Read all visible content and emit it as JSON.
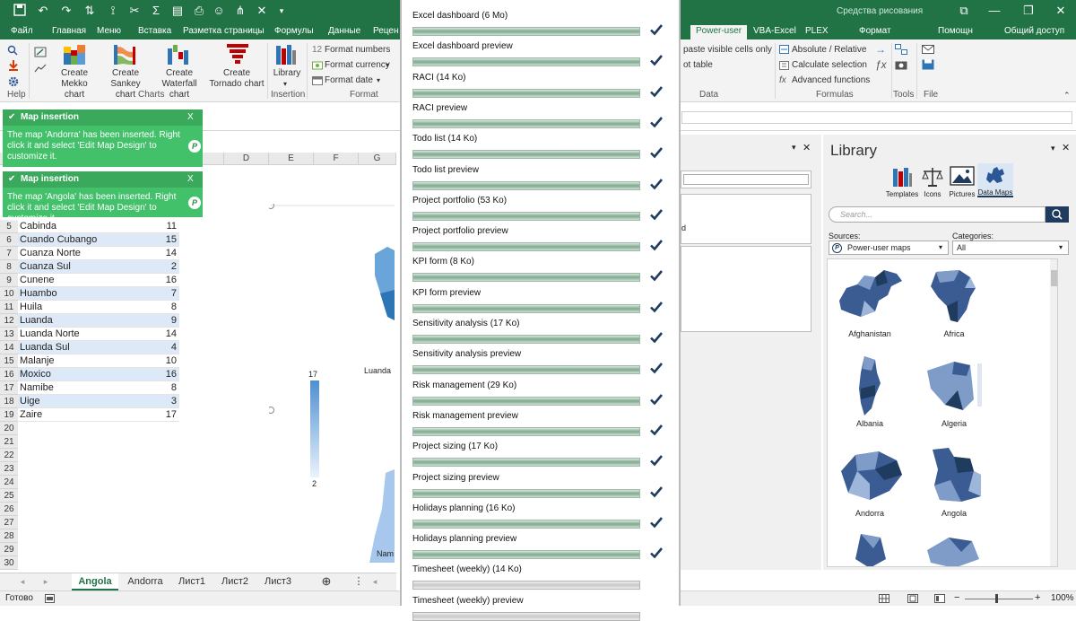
{
  "titlebar": {
    "context_label": "Средства рисования",
    "window_buttons": {
      "restore_alt": "⧉",
      "minimize": "—",
      "maximize": "❐",
      "close": "✕"
    }
  },
  "tabs": [
    {
      "label": "Файл"
    },
    {
      "label": "Главная"
    },
    {
      "label": "Меню"
    },
    {
      "label": "Вставка"
    },
    {
      "label": "Разметка страницы"
    },
    {
      "label": "Формулы"
    },
    {
      "label": "Данные"
    },
    {
      "label": "Рецен"
    },
    {
      "label": "Power-user"
    },
    {
      "label": "VBA-Excel"
    },
    {
      "label": "PLEX"
    },
    {
      "label": "Формат"
    },
    {
      "label": "Помощн"
    },
    {
      "label": "Общий доступ"
    }
  ],
  "ribbon": {
    "help_label": "Help",
    "charts_group": "Charts",
    "insertion_group": "Insertion",
    "format_group": "Format",
    "data_group": "Data",
    "formulas_group": "Formulas",
    "tools_group": "Tools",
    "file_group": "File",
    "mekko": "Create Mekko chart",
    "sankey": "Create Sankey chart",
    "waterfall": "Create Waterfall chart",
    "tornado": "Create Tornado chart",
    "library": "Library",
    "format_numbers": "Format numbers",
    "format_currency": "Format currency",
    "format_date": "Format date",
    "paste_visible": "paste visible cells only",
    "pivot_table": "ot table",
    "absolute_relative": "Absolute / Relative",
    "calculate_selection": "Calculate selection",
    "advanced_functions": "Advanced functions",
    "format_numbers_prefix": "12"
  },
  "toasts": [
    {
      "title": "Map insertion",
      "close": "X",
      "body": "The map 'Andorra' has been inserted. Right click it and select 'Edit Map Design' to customize it."
    },
    {
      "title": "Map insertion",
      "close": "X",
      "body": "The map 'Angola' has been inserted. Right click it and select 'Edit Map Design' to customize it."
    }
  ],
  "sheet": {
    "columns": [
      "D",
      "E",
      "F",
      "G"
    ],
    "rows": [
      {
        "num": "5",
        "name": "Cabinda",
        "value": "11"
      },
      {
        "num": "6",
        "name": "Cuando Cubango",
        "value": "15"
      },
      {
        "num": "7",
        "name": "Cuanza Norte",
        "value": "14"
      },
      {
        "num": "8",
        "name": "Cuanza Sul",
        "value": "2"
      },
      {
        "num": "9",
        "name": "Cunene",
        "value": "16"
      },
      {
        "num": "10",
        "name": "Huambo",
        "value": "7"
      },
      {
        "num": "11",
        "name": "Huila",
        "value": "8"
      },
      {
        "num": "12",
        "name": "Luanda",
        "value": "9"
      },
      {
        "num": "13",
        "name": "Luanda Norte",
        "value": "14"
      },
      {
        "num": "14",
        "name": "Luanda Sul",
        "value": "4"
      },
      {
        "num": "15",
        "name": "Malanje",
        "value": "10"
      },
      {
        "num": "16",
        "name": "Moxico",
        "value": "16"
      },
      {
        "num": "17",
        "name": "Namibe",
        "value": "8"
      },
      {
        "num": "18",
        "name": "Uige",
        "value": "3"
      },
      {
        "num": "19",
        "name": "Zaire",
        "value": "17"
      },
      {
        "num": "20",
        "name": "",
        "value": ""
      },
      {
        "num": "21",
        "name": "",
        "value": ""
      },
      {
        "num": "22",
        "name": "",
        "value": ""
      },
      {
        "num": "23",
        "name": "",
        "value": ""
      },
      {
        "num": "24",
        "name": "",
        "value": ""
      },
      {
        "num": "25",
        "name": "",
        "value": ""
      },
      {
        "num": "26",
        "name": "",
        "value": ""
      },
      {
        "num": "27",
        "name": "",
        "value": ""
      },
      {
        "num": "28",
        "name": "",
        "value": ""
      },
      {
        "num": "29",
        "name": "",
        "value": ""
      },
      {
        "num": "30",
        "name": "",
        "value": ""
      }
    ],
    "legend_max": "17",
    "legend_min": "2",
    "map_label_luanda": "Luanda",
    "map_label_partial": "Nam"
  },
  "sheet_tabs": [
    {
      "label": "Angola",
      "active": true
    },
    {
      "label": "Andorra",
      "active": false
    },
    {
      "label": "Лист1",
      "active": false
    },
    {
      "label": "Лист2",
      "active": false
    },
    {
      "label": "Лист3",
      "active": false
    }
  ],
  "status": {
    "ready": "Готово",
    "zoom": "100%"
  },
  "downloads": [
    {
      "label": "Excel dashboard (6 Mo)",
      "done": true
    },
    {
      "label": "Excel dashboard preview",
      "done": true
    },
    {
      "label": "RACI (14 Ko)",
      "done": true
    },
    {
      "label": "RACI preview",
      "done": true
    },
    {
      "label": "Todo list (14 Ko)",
      "done": true
    },
    {
      "label": "Todo list preview",
      "done": true
    },
    {
      "label": "Project portfolio (53 Ko)",
      "done": true
    },
    {
      "label": "Project portfolio preview",
      "done": true
    },
    {
      "label": "KPI form (8 Ko)",
      "done": true
    },
    {
      "label": "KPI form preview",
      "done": true
    },
    {
      "label": "Sensitivity analysis (17 Ko)",
      "done": true
    },
    {
      "label": "Sensitivity analysis preview",
      "done": true
    },
    {
      "label": "Risk management (29 Ko)",
      "done": true
    },
    {
      "label": "Risk management preview",
      "done": true
    },
    {
      "label": "Project sizing (17 Ko)",
      "done": true
    },
    {
      "label": "Project sizing preview",
      "done": true
    },
    {
      "label": "Holidays planning (16 Ko)",
      "done": true
    },
    {
      "label": "Holidays planning preview",
      "done": true
    },
    {
      "label": "Timesheet (weekly) (14 Ko)",
      "done": false
    },
    {
      "label": "Timesheet (weekly) preview",
      "done": false
    }
  ],
  "midpane": {
    "partial_text": "d"
  },
  "library": {
    "title": "Library",
    "nav": [
      {
        "label": "Templates"
      },
      {
        "label": "Icons"
      },
      {
        "label": "Pictures"
      },
      {
        "label": "Data Maps"
      }
    ],
    "search_placeholder": "Search...",
    "sources_label": "Sources:",
    "sources_value": "Power-user maps",
    "categories_label": "Categories:",
    "categories_value": "All",
    "maps": [
      {
        "label": "Afghanistan"
      },
      {
        "label": "Africa"
      },
      {
        "label": "Albania"
      },
      {
        "label": "Algeria"
      },
      {
        "label": "Andorra"
      },
      {
        "label": "Angola"
      }
    ]
  },
  "colors": {
    "excel_green": "#217346",
    "toast_green": "#43c06a",
    "map_blue": "#3b5b93",
    "legend_blue": "#6aa5da"
  }
}
